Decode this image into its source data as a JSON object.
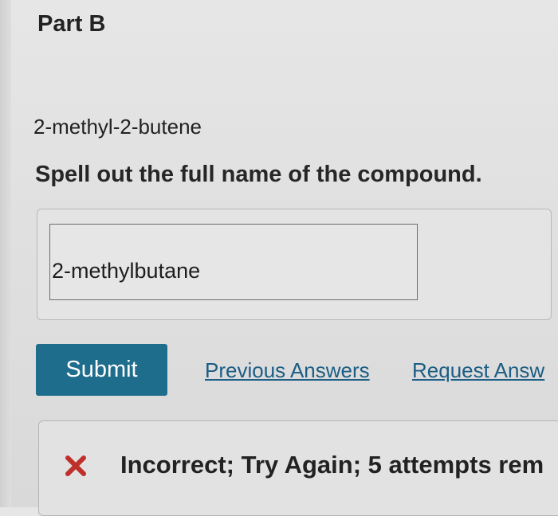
{
  "part": {
    "title": "Part B"
  },
  "question": {
    "compound": "2-methyl-2-butene",
    "instruction": "Spell out the full name of the compound."
  },
  "answer": {
    "value": "2-methylbutane"
  },
  "actions": {
    "submit_label": "Submit",
    "previous_answers_label": "Previous Answers",
    "request_answer_label": "Request Answ"
  },
  "feedback": {
    "icon": "x-icon",
    "icon_color": "#c0302b",
    "message": "Incorrect; Try Again; 5 attempts rem"
  },
  "colors": {
    "submit_bg": "#1f6d8c",
    "link": "#1b5d84"
  }
}
